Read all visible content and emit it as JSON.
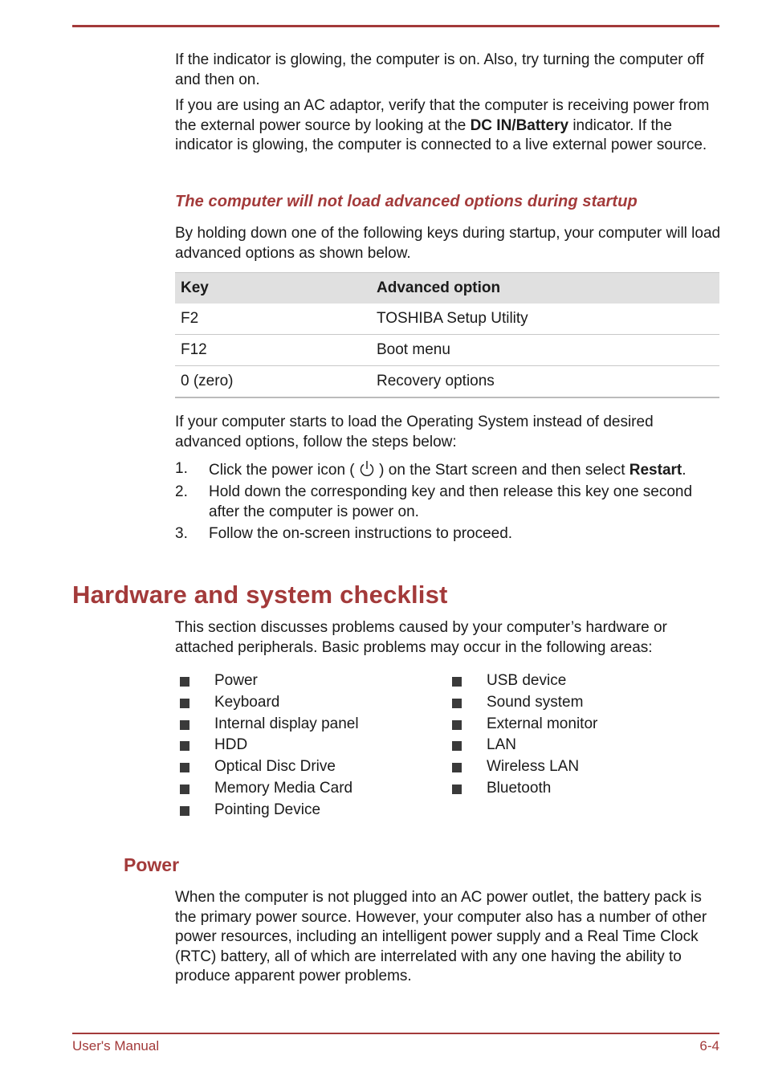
{
  "paragraphs": {
    "indicator_on": "If the indicator is glowing, the computer is on. Also, try turning the computer off and then on.",
    "ac_adaptor_before": "If you are using an AC adaptor, verify that the computer is receiving power from the external power source by looking at the ",
    "ac_adaptor_bold": "DC IN/Battery",
    "ac_adaptor_after": " indicator. If the indicator is glowing, the computer is connected to a live external power source."
  },
  "advanced_section": {
    "heading": "The computer will not load advanced options during startup",
    "intro": "By holding down one of the following keys during startup, your computer will load advanced options as shown below.",
    "table": {
      "headers": [
        "Key",
        "Advanced option"
      ],
      "rows": [
        [
          "F2",
          "TOSHIBA Setup Utility"
        ],
        [
          "F12",
          "Boot menu"
        ],
        [
          "0 (zero)",
          "Recovery options"
        ]
      ]
    },
    "followup": "If your computer starts to load the Operating System instead of desired advanced options, follow the steps below:",
    "steps": [
      {
        "num": "1.",
        "before": "Click the power icon ( ",
        "icon": "power-icon",
        "after": " ) on the Start screen and then select ",
        "bold": "Restart",
        "end": "."
      },
      {
        "num": "2.",
        "text": "Hold down the corresponding key and then release this key one second after the computer is power on."
      },
      {
        "num": "3.",
        "text": "Follow the on-screen instructions to proceed."
      }
    ]
  },
  "checklist_section": {
    "heading": "Hardware and system checklist",
    "intro": "This section discusses problems caused by your computer’s hardware or attached peripherals. Basic problems may occur in the following areas:",
    "left_items": [
      "Power",
      "Keyboard",
      "Internal display panel",
      "HDD",
      "Optical Disc Drive",
      "Memory Media Card",
      "Pointing Device"
    ],
    "right_items": [
      "USB device",
      "Sound system",
      "External monitor",
      "LAN",
      "Wireless LAN",
      "Bluetooth"
    ]
  },
  "power_section": {
    "heading": "Power",
    "text": "When the computer is not plugged into an AC power outlet, the battery pack is the primary power source. However, your computer also has a number of other power resources, including an intelligent power supply and a Real Time Clock (RTC) battery, all of which are interrelated with any one having the ability to produce apparent power problems."
  },
  "footer": {
    "left": "User's Manual",
    "right": "6-4"
  },
  "colors": {
    "accent": "#a33a3a",
    "table_header_bg": "#e0e0e0"
  }
}
